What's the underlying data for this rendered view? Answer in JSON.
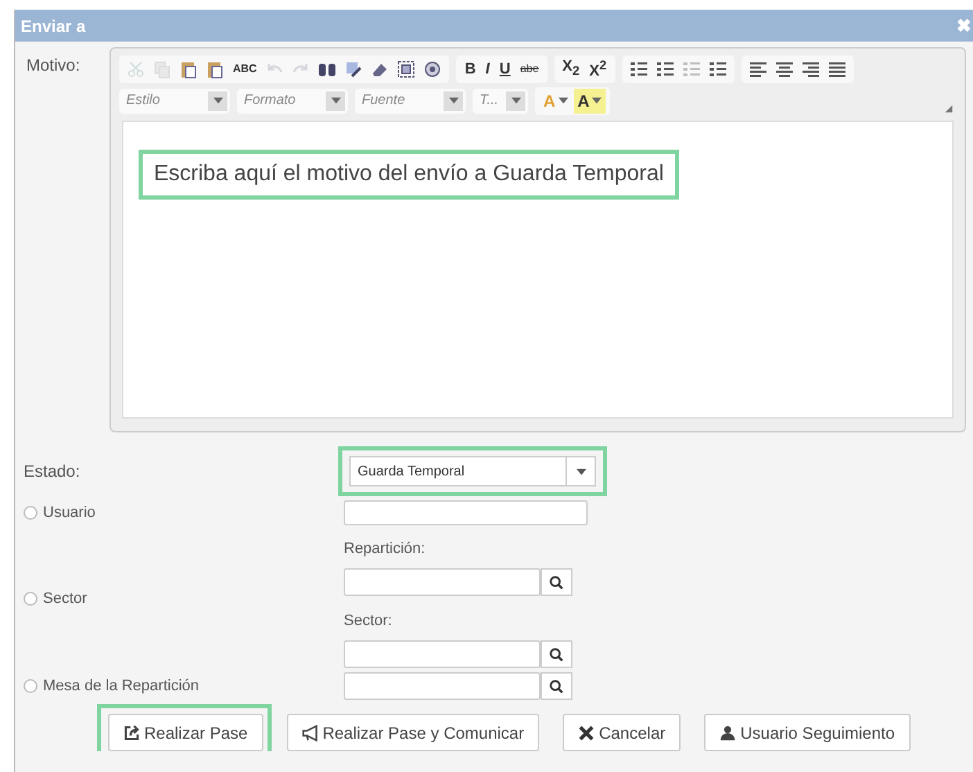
{
  "window": {
    "title": "Enviar a",
    "close": "✖"
  },
  "motivo": {
    "label": "Motivo:",
    "toolbar": {
      "icon_groups": [
        [
          {
            "disabled": true
          },
          {
            "disabled": true
          },
          {
            "disabled": false
          },
          {
            "disabled": false
          },
          {
            "disabled": false,
            "text": "ABC"
          },
          {
            "disabled": true
          },
          {
            "disabled": true
          },
          {
            "disabled": false
          },
          {
            "disabled": false
          },
          {
            "disabled": false
          },
          {
            "disabled": false
          },
          {
            "disabled": false
          }
        ]
      ],
      "format_buttons": [
        "B",
        "I",
        "U",
        "abe"
      ],
      "script_buttons": [
        "X$_{2}$",
        "X$^{2}$"
      ],
      "list_icons": [
        {
          "disabled": false
        },
        {
          "disabled": false
        },
        {
          "disabled": true
        },
        {
          "disabled": false
        }
      ],
      "align_icons": [
        {
          "disabled": false
        },
        {
          "disabled": false
        },
        {
          "disabled": false
        },
        {
          "disabled": false
        }
      ],
      "combos": [
        "Estilo",
        "Formato",
        "Fuente",
        "T..."
      ],
      "color_buttons": [
        "A",
        "A"
      ]
    },
    "content": "Escriba aquí el motivo del envío a Guarda Temporal",
    "highlighted": true
  },
  "estado": {
    "label": "Estado:",
    "value": "Guarda Temporal",
    "highlighted": true
  },
  "destinations": [
    {
      "label": "Usuario",
      "selected": false,
      "fields": [
        {
          "kind": "plain"
        }
      ]
    },
    {
      "label": "Sector",
      "selected": false,
      "fields": [
        {
          "kind": "search",
          "label": "Repartición:"
        },
        {
          "kind": "search",
          "label": "Sector:"
        }
      ]
    },
    {
      "label": "Mesa de la Repartición",
      "selected": false,
      "fields": [
        {
          "kind": "search"
        }
      ]
    }
  ],
  "buttons": [
    {
      "label": "Realizar Pase",
      "kind": "share",
      "highlighted": true
    },
    {
      "label": "Realizar Pase y Comunicar",
      "kind": "megaphone",
      "highlighted": false
    },
    {
      "label": "Cancelar",
      "kind": "cross",
      "highlighted": false
    },
    {
      "label": "Usuario Seguimiento",
      "kind": "user",
      "highlighted": false
    }
  ]
}
